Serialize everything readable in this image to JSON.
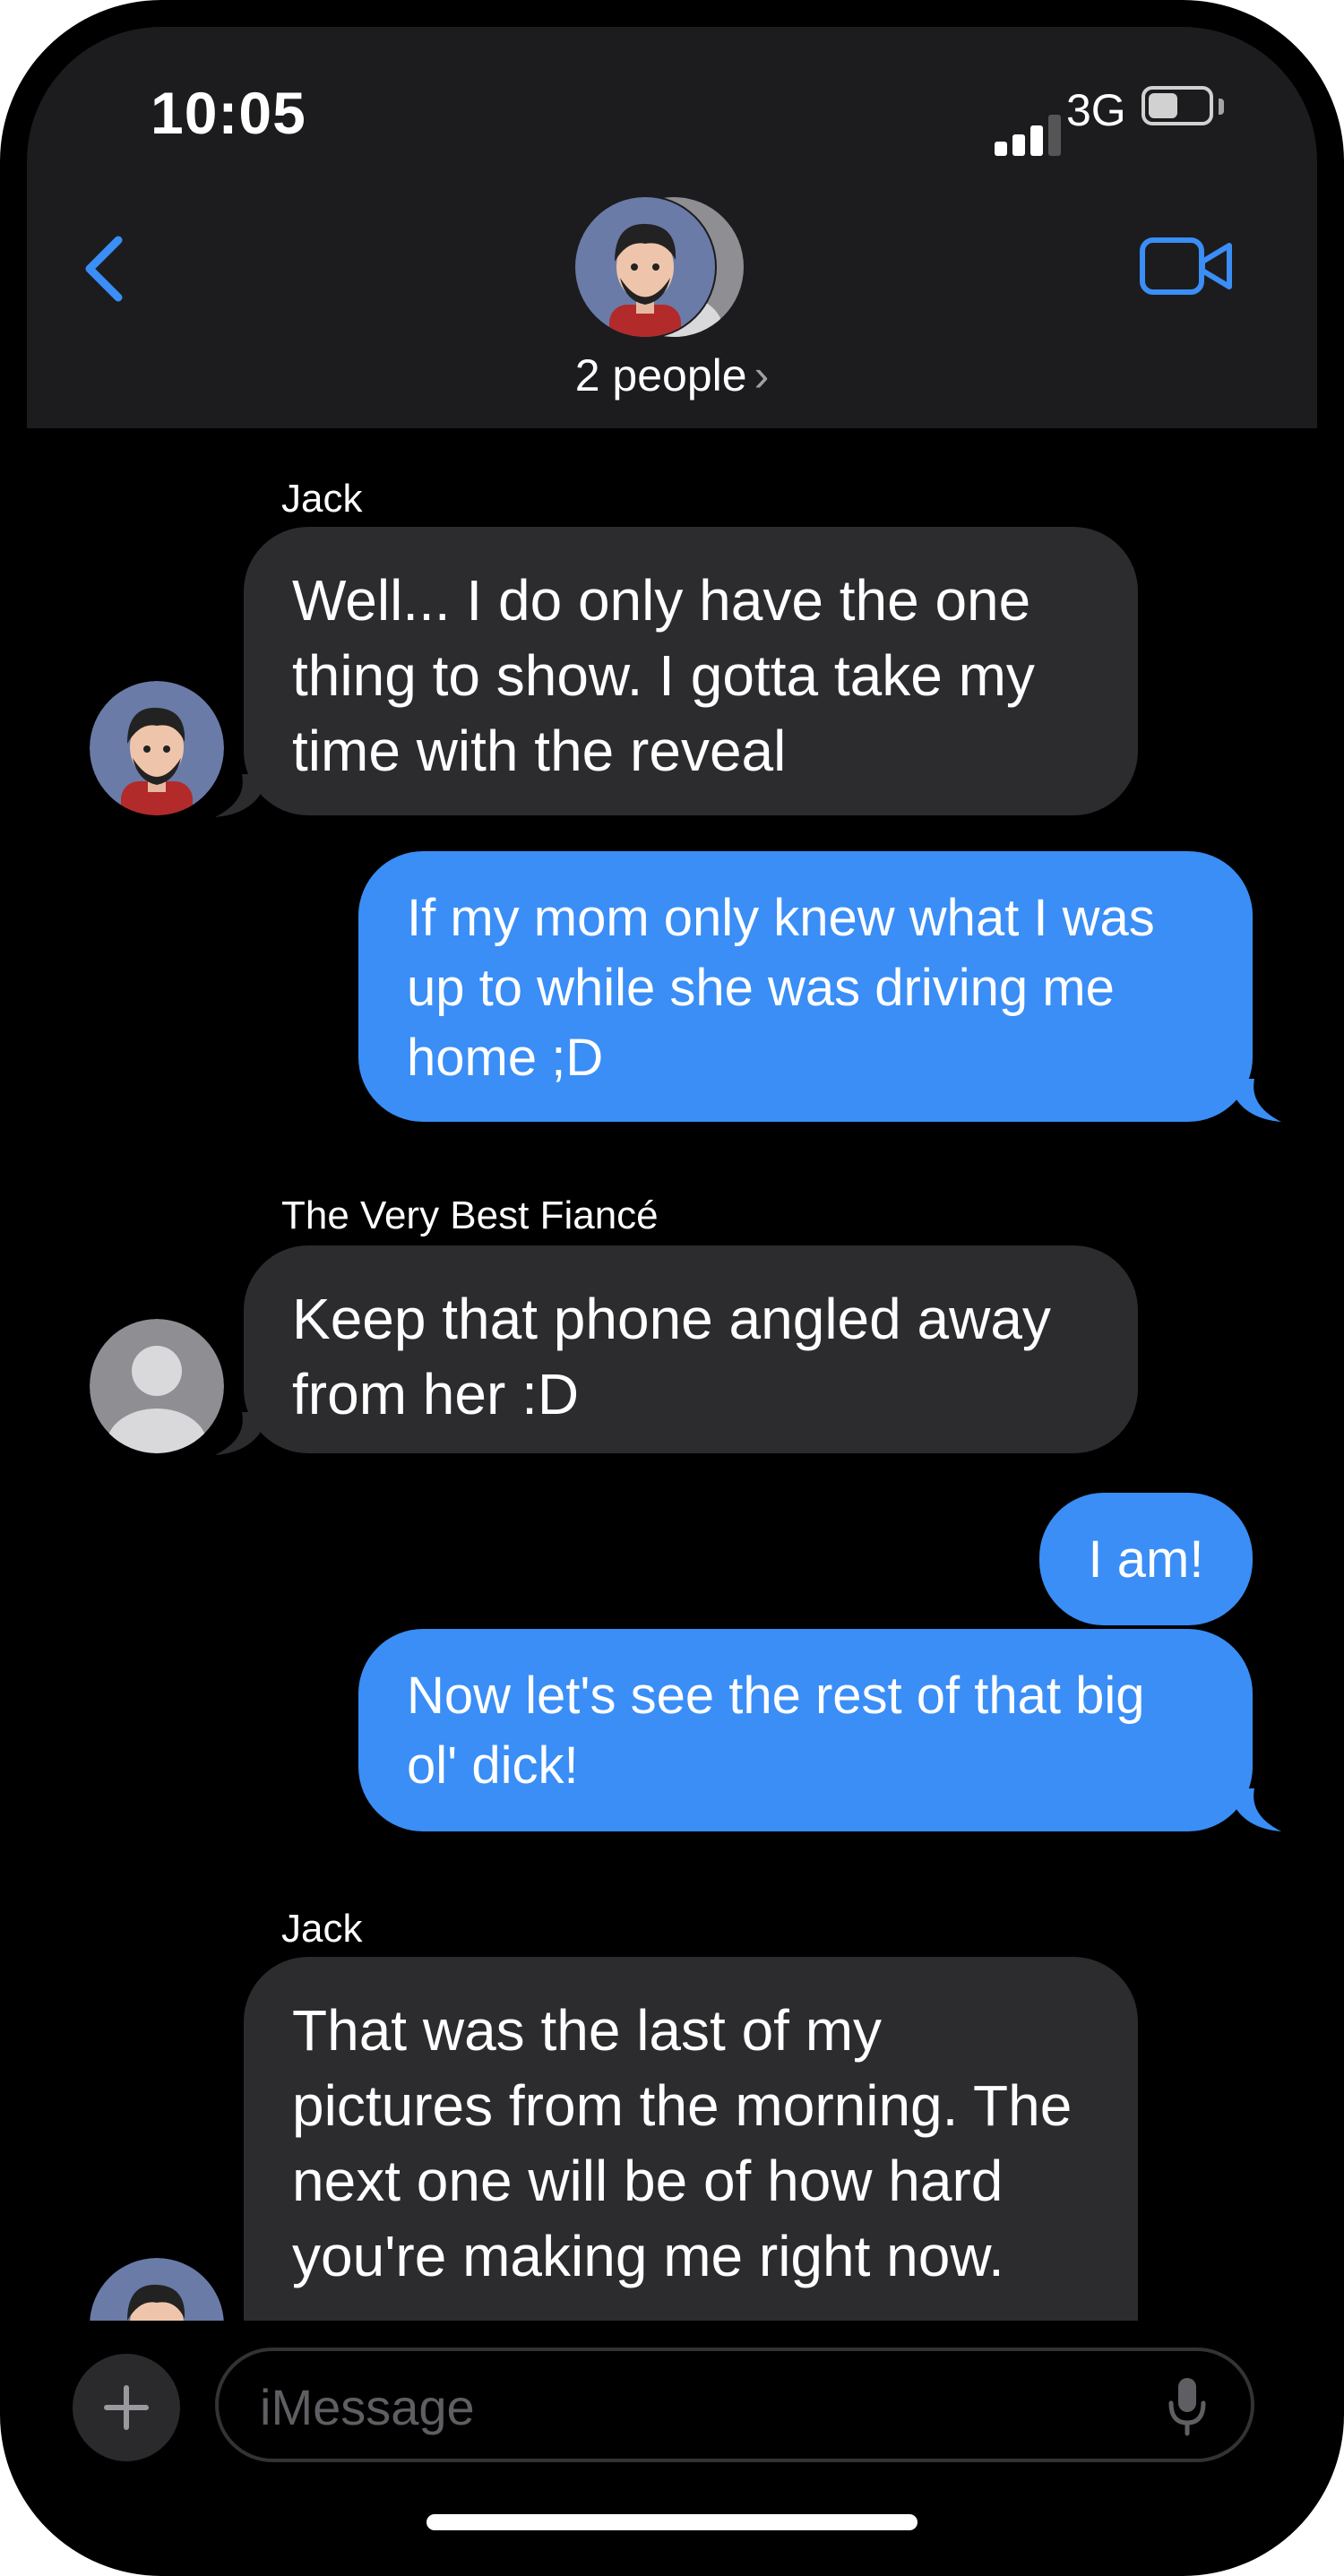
{
  "status": {
    "time": "10:05",
    "network": "3G"
  },
  "conversation": {
    "participants_label": "2 people",
    "chevron": "›"
  },
  "icons": {
    "back": "chevron-left-icon",
    "video": "video-camera-icon",
    "plus": "plus-icon",
    "mic": "microphone-icon"
  },
  "colors": {
    "accent": "#3a8ef6",
    "incoming_bubble": "#2c2c2e",
    "background": "#000000"
  },
  "messages": [
    {
      "sender": "Jack",
      "direction": "incoming",
      "text": "Well... I do only have the one thing to show.  I gotta take my time with the reveal"
    },
    {
      "sender": "",
      "direction": "outgoing",
      "text": "If my mom only knew what I was up to while she was driving me home ;D"
    },
    {
      "sender": "The Very Best Fiancé",
      "direction": "incoming",
      "text": "Keep that phone angled away from her :D"
    },
    {
      "sender": "",
      "direction": "outgoing",
      "text": "I am!"
    },
    {
      "sender": "",
      "direction": "outgoing",
      "text": "Now let's see the rest of that big ol' dick!"
    },
    {
      "sender": "Jack",
      "direction": "incoming",
      "text": "That was the last of my pictures from the morning. The next one will be of how hard you're making me right now."
    }
  ],
  "composer": {
    "placeholder": "iMessage"
  }
}
